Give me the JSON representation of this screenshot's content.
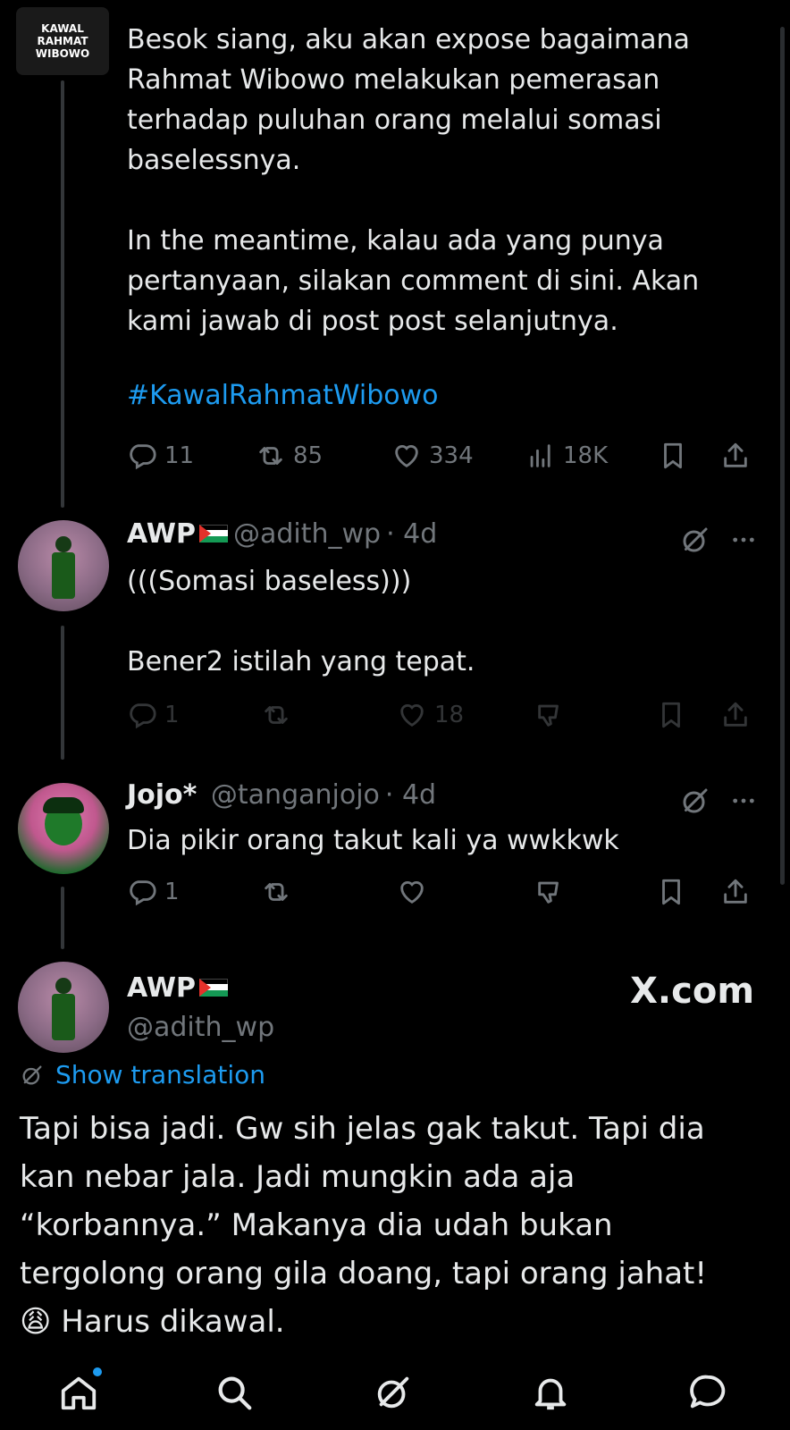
{
  "tweet_main": {
    "avatar_text": [
      "KAWAL",
      "RAHMAT",
      "WIBOWO"
    ],
    "body": "Besok siang, aku akan expose bagaimana\nRahmat Wibowo melakukan pemerasan\nterhadap puluhan orang melalui somasi\nbaselessnya.\n\nIn the meantime, kalau ada yang punya\npertanyaan, silakan comment di sini. Akan\nkami jawab di post post selanjutnya.",
    "hashtag": "#KawalRahmatWibowo",
    "replies": "11",
    "reposts": "85",
    "likes": "334",
    "views": "18K"
  },
  "reply1": {
    "name": "AWP",
    "handle": "@adith_wp",
    "time": "· 4d",
    "body": "(((Somasi baseless)))\n\nBener2 istilah yang tepat.",
    "replies": "1",
    "likes": "18"
  },
  "reply2": {
    "name": "Jojo*",
    "handle": "@tanganjojo",
    "time": "· 4d",
    "body": "Dia pikir orang takut kali ya wwkkwk",
    "replies": "1"
  },
  "focus": {
    "name": "AWP",
    "handle": "@adith_wp",
    "watermark": "X.com",
    "translation_label": "Show translation",
    "body": "Tapi bisa jadi. Gw sih jelas gak takut. Tapi dia\nkan nebar jala. Jadi mungkin ada aja\n“korbannya.” Makanya dia udah bukan\ntergolong orang gila doang, tapi orang jahat!",
    "emoji": "😩",
    "body_last": "Harus dikawal."
  },
  "icons": {
    "reply": "reply-icon",
    "repost": "repost-icon",
    "like": "heart-icon",
    "views": "views-icon",
    "bookmark": "bookmark-icon",
    "share": "share-icon",
    "grok": "grok-icon",
    "more": "more-icon",
    "dislike": "downvote-icon",
    "nav": [
      "home-icon",
      "search-icon",
      "grok-icon",
      "notifications-icon",
      "messages-icon"
    ]
  },
  "colors": {
    "background": "#000000",
    "text": "#e7e9ea",
    "secondary": "#71767b",
    "accent": "#1d9bf0"
  }
}
